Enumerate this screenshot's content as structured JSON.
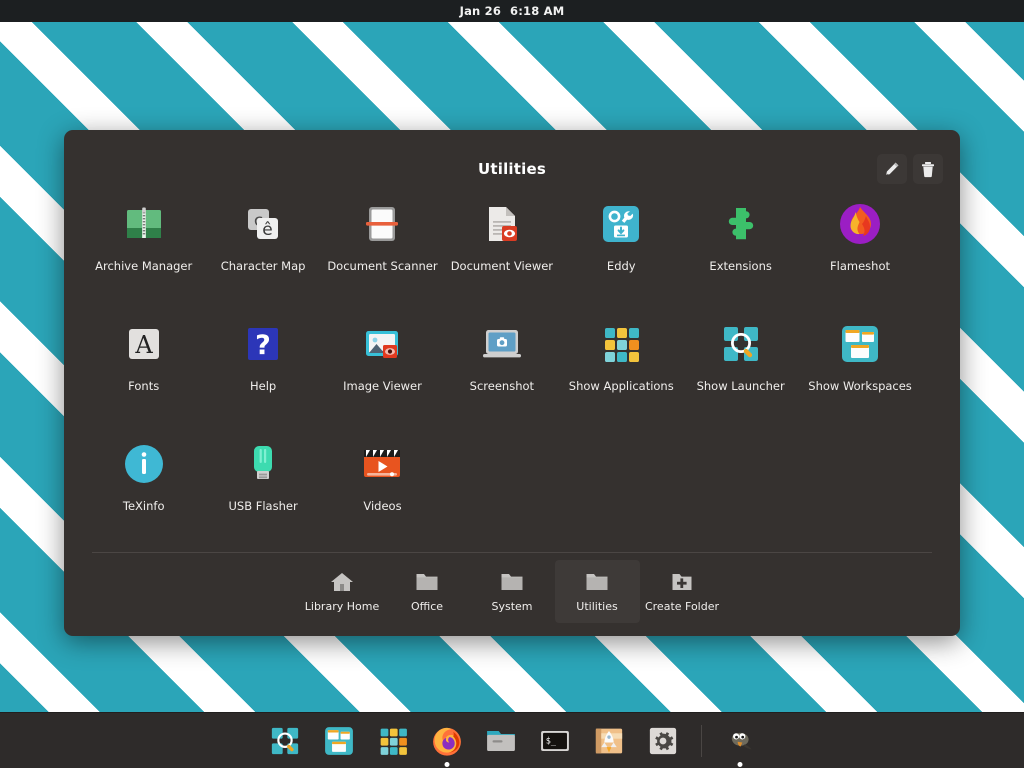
{
  "topbar": {
    "date": "Jan 26",
    "time": "6:18 AM"
  },
  "dialog": {
    "title": "Utilities",
    "actions": [
      {
        "name": "edit-button",
        "icon": "pencil-icon",
        "label": "Edit"
      },
      {
        "name": "delete-button",
        "icon": "trash-icon",
        "label": "Delete"
      }
    ]
  },
  "apps": [
    {
      "label": "Archive Manager",
      "icon": "archive-manager-icon"
    },
    {
      "label": "Character Map",
      "icon": "character-map-icon"
    },
    {
      "label": "Document Scanner",
      "icon": "document-scanner-icon"
    },
    {
      "label": "Document Viewer",
      "icon": "document-viewer-icon"
    },
    {
      "label": "Eddy",
      "icon": "eddy-icon"
    },
    {
      "label": "Extensions",
      "icon": "extensions-icon"
    },
    {
      "label": "Flameshot",
      "icon": "flameshot-icon"
    },
    {
      "label": "Fonts",
      "icon": "fonts-icon"
    },
    {
      "label": "Help",
      "icon": "help-icon"
    },
    {
      "label": "Image Viewer",
      "icon": "image-viewer-icon"
    },
    {
      "label": "Screenshot",
      "icon": "screenshot-icon"
    },
    {
      "label": "Show Applications",
      "icon": "show-applications-icon"
    },
    {
      "label": "Show Launcher",
      "icon": "show-launcher-icon"
    },
    {
      "label": "Show Workspaces",
      "icon": "show-workspaces-icon"
    },
    {
      "label": "TeXinfo",
      "icon": "texinfo-icon"
    },
    {
      "label": "USB Flasher",
      "icon": "usb-flasher-icon"
    },
    {
      "label": "Videos",
      "icon": "videos-icon"
    }
  ],
  "folders": [
    {
      "label": "Library Home",
      "icon": "home-icon",
      "active": false
    },
    {
      "label": "Office",
      "icon": "folder-icon",
      "active": false
    },
    {
      "label": "System",
      "icon": "folder-icon",
      "active": false
    },
    {
      "label": "Utilities",
      "icon": "folder-icon",
      "active": true
    },
    {
      "label": "Create Folder",
      "icon": "folder-plus-icon",
      "active": false
    }
  ],
  "dock": [
    {
      "name": "show-launcher",
      "icon": "show-launcher-icon",
      "running": false
    },
    {
      "name": "show-workspaces",
      "icon": "show-workspaces-icon",
      "running": false
    },
    {
      "name": "show-applications",
      "icon": "show-applications-icon",
      "running": false
    },
    {
      "name": "firefox",
      "icon": "firefox-icon",
      "running": true
    },
    {
      "name": "files",
      "icon": "files-icon",
      "running": false
    },
    {
      "name": "terminal",
      "icon": "terminal-icon",
      "running": false
    },
    {
      "name": "launcher-rocket",
      "icon": "rocket-icon",
      "running": false
    },
    {
      "name": "settings",
      "icon": "gear-icon",
      "running": false
    },
    {
      "name": "gimp",
      "icon": "gimp-icon",
      "running": true
    }
  ],
  "colors": {
    "desktop_teal": "#2ba5b8",
    "desktop_stripe": "#ffffff",
    "panel_dark": "#1c1f21",
    "dialog_bg": "#35312f",
    "dock_bg": "#2e2b2a",
    "accent_text": "#f0eeec"
  }
}
